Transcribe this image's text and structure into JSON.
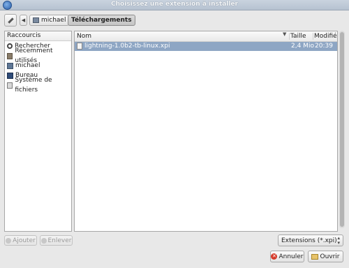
{
  "window": {
    "title": "Choisissez une extension à installer"
  },
  "pathbar": {
    "crumbs": [
      "michael",
      "Téléchargements"
    ]
  },
  "sidebar": {
    "header": "Raccourcis",
    "items": [
      {
        "label": "Rechercher",
        "icon": "search-icon"
      },
      {
        "label": "Récemment utilisés",
        "icon": "recent-icon"
      },
      {
        "label": "michael",
        "icon": "home-folder-icon"
      },
      {
        "label": "Bureau",
        "icon": "desktop-icon"
      },
      {
        "label": "Système de fichiers",
        "icon": "drive-icon"
      }
    ]
  },
  "files": {
    "columns": {
      "name": "Nom",
      "size": "Taille",
      "modified": "Modifié"
    },
    "rows": [
      {
        "name": "lightning-1.0b2-tb-linux.xpi",
        "size": "2,4 Mio",
        "modified": "20:39",
        "selected": true
      }
    ]
  },
  "bottom": {
    "add_label": "Ajouter",
    "remove_label": "Enlever",
    "filter_value": "Extensions (*.xpi)",
    "cancel_label": "Annuler",
    "open_label": "Ouvrir"
  },
  "colors": {
    "selection": "#8ea6c4",
    "titlebar": "#b6c2d0"
  }
}
